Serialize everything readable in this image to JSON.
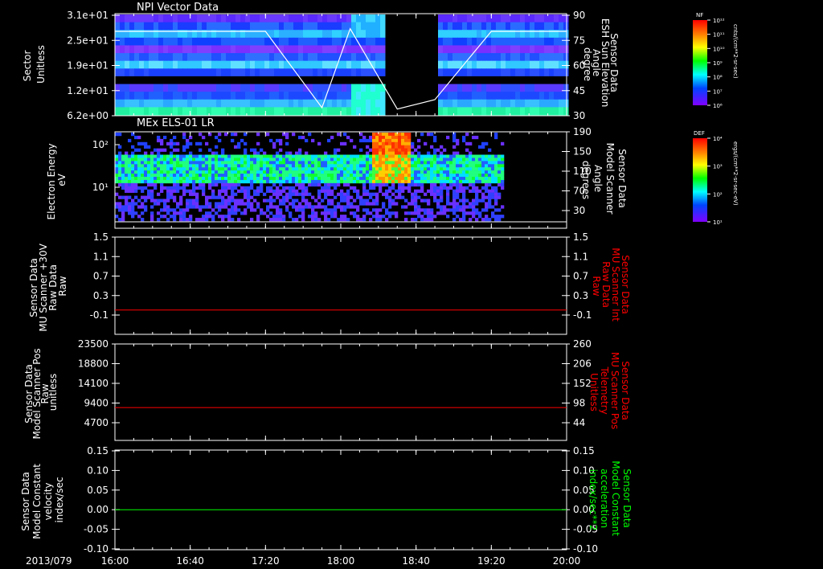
{
  "date_label": "2013/079",
  "time_ticks": [
    "16:00",
    "16:40",
    "17:20",
    "18:00",
    "18:40",
    "19:20",
    "20:00"
  ],
  "colors": {
    "bg": "#000000",
    "axis": "#ffffff",
    "red_trace": "#ff0000",
    "green_trace": "#00ff00"
  },
  "chart_data": [
    {
      "type": "heatmap",
      "title": "NPI Vector Data",
      "left_axis": {
        "label_lines": [
          "Sector",
          "Unitless"
        ],
        "ticks": [
          "3.1e+01",
          "2.5e+01",
          "1.9e+01",
          "1.2e+01",
          "6.2e+00"
        ]
      },
      "right_axis": {
        "label_lines": [
          "Sensor Data",
          "ESH Sun Elevation",
          "Angle",
          "degree"
        ],
        "ticks": [
          "90",
          "75",
          "60",
          "45",
          "30"
        ],
        "ylim": [
          15,
          90
        ]
      },
      "overlay_line": {
        "name": "ESH Sun Elevation",
        "x": [
          "16:00",
          "17:20",
          "17:50",
          "18:05",
          "18:30",
          "18:50",
          "19:20",
          "20:00"
        ],
        "y": [
          78,
          78,
          21,
          80,
          20,
          27,
          78,
          78
        ]
      },
      "colorbar": {
        "label": "NF",
        "unit": "cnts/(cm**2-sr-sec)",
        "ticks": [
          "10¹²",
          "10¹¹",
          "10¹⁰",
          "10⁹",
          "10⁸",
          "10⁷",
          "10⁶"
        ]
      }
    },
    {
      "type": "heatmap",
      "title": "MEx ELS-01 LR",
      "left_axis": {
        "label_lines": [
          "Electron Energy",
          "eV"
        ],
        "ticks": [
          "10²",
          "10¹"
        ]
      },
      "right_axis": {
        "label_lines": [
          "Sensor Data",
          "Model Scanner",
          "Angle",
          "degrees"
        ],
        "ticks": [
          "190",
          "150",
          "110",
          "70",
          "30"
        ]
      },
      "colorbar": {
        "label": "DEF",
        "unit": "ergs/(cm**2-sr-sec-eV)",
        "ticks": [
          "10⁴",
          "10³",
          "10²",
          "10¹"
        ]
      }
    },
    {
      "type": "line",
      "left_axis": {
        "label_lines": [
          "Sensor Data",
          "MU Scanner +30V",
          "Raw Data",
          "Raw"
        ],
        "ticks": [
          "1.5",
          "1.1",
          "0.7",
          "0.3",
          "-0.1"
        ],
        "ylim": [
          -0.5,
          1.5
        ]
      },
      "right_axis": {
        "label_lines": [
          "Sensor Data",
          "MU Scanner Int",
          "Raw Data",
          "Raw"
        ],
        "ticks": [
          "1.5",
          "1.1",
          "0.7",
          "0.3",
          "-0.1"
        ],
        "ylim": [
          -0.5,
          1.5
        ]
      },
      "series": [
        {
          "x": [
            "16:00",
            "20:00"
          ],
          "y": [
            0.0,
            0.0
          ]
        }
      ]
    },
    {
      "type": "line",
      "left_axis": {
        "label_lines": [
          "Sensor Data",
          "Model Scanner Pos",
          "Raw",
          "unitless"
        ],
        "ticks": [
          "23500",
          "18800",
          "14100",
          "9400",
          "4700"
        ],
        "ylim": [
          0,
          23500
        ]
      },
      "right_axis": {
        "label_lines": [
          "Sensor Data",
          "MU Scanner Pos",
          "Telemetry",
          "Unitless"
        ],
        "ticks": [
          "260",
          "206",
          "152",
          "98",
          "44"
        ],
        "ylim": [
          0,
          260
        ]
      },
      "series": [
        {
          "x": [
            "16:00",
            "20:00"
          ],
          "y": [
            8000,
            8000
          ]
        }
      ]
    },
    {
      "type": "line",
      "left_axis": {
        "label_lines": [
          "Sensor Data",
          "Model Constant",
          "velocity",
          "index/sec"
        ],
        "ticks": [
          "0.15",
          "0.10",
          "0.05",
          "0.00",
          "-0.05",
          "-0.10"
        ],
        "ylim": [
          -0.1,
          0.15
        ]
      },
      "right_axis": {
        "label_lines": [
          "Sensor Data",
          "Model Constant",
          "acceleration",
          "index/sec**2"
        ],
        "ticks": [
          "0.15",
          "0.10",
          "0.05",
          "0.00",
          "-0.05",
          "-0.10"
        ],
        "ylim": [
          -0.1,
          0.15
        ]
      },
      "series": [
        {
          "x": [
            "16:00",
            "20:00"
          ],
          "y": [
            0.0,
            0.0
          ]
        }
      ]
    }
  ]
}
